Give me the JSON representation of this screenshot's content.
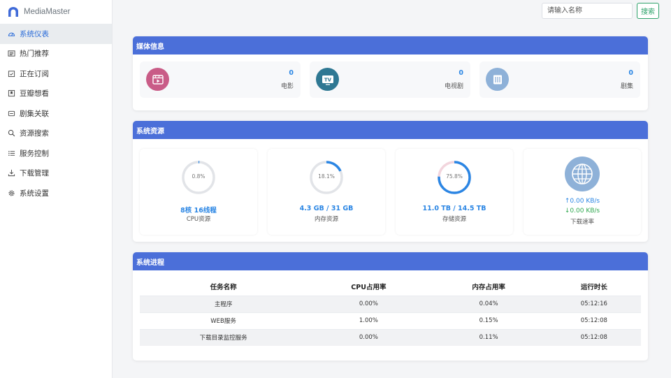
{
  "app": {
    "name": "MediaMaster"
  },
  "sidebar": {
    "items": [
      {
        "label": "系统仪表",
        "icon": "dashboard-icon",
        "active": true
      },
      {
        "label": "热门推荐",
        "icon": "newspaper-icon"
      },
      {
        "label": "正在订阅",
        "icon": "calendar-check-icon"
      },
      {
        "label": "豆瓣想看",
        "icon": "bookmark-box-icon"
      },
      {
        "label": "剧集关联",
        "icon": "link-box-icon"
      },
      {
        "label": "资源搜索",
        "icon": "search-icon"
      },
      {
        "label": "服务控制",
        "icon": "list-icon"
      },
      {
        "label": "下载管理",
        "icon": "download-icon"
      },
      {
        "label": "系统设置",
        "icon": "gear-icon"
      }
    ]
  },
  "search": {
    "placeholder": "请输入名称",
    "button_label": "搜索"
  },
  "media": {
    "title": "媒体信息",
    "tiles": [
      {
        "value": "0",
        "label": "电影",
        "icon": "film-icon",
        "color": "#c95c87"
      },
      {
        "value": "0",
        "label": "电视剧",
        "icon": "tv-icon",
        "color": "#2f7893"
      },
      {
        "value": "0",
        "label": "剧集",
        "icon": "episode-icon",
        "color": "#8eb1d8"
      }
    ]
  },
  "resources": {
    "title": "系统资源",
    "cpu": {
      "percent_text": "0.8%",
      "percent": 0.8,
      "value": "8核 16线程",
      "label": "CPU资源"
    },
    "memory": {
      "percent_text": "18.1%",
      "percent": 18.1,
      "value": "4.3 GB / 31 GB",
      "label": "内存资源"
    },
    "storage": {
      "percent_text": "75.8%",
      "percent": 75.8,
      "value": "11.0 TB / 14.5 TB",
      "label": "存储资源"
    },
    "network": {
      "up": "↑0.00 KB/s",
      "down": "↓0.00 KB/s",
      "label": "下载速率",
      "icon": "globe-icon"
    },
    "colors": {
      "ring_fill": "#2b86e4",
      "ring_track": "#e2e4e8",
      "storage_remain": "#f2d5dd"
    }
  },
  "processes": {
    "title": "系统进程",
    "headers": [
      "任务名称",
      "CPU占用率",
      "内存占用率",
      "运行时长"
    ],
    "rows": [
      [
        "主程序",
        "0.00%",
        "0.04%",
        "05:12:16"
      ],
      [
        "WEB服务",
        "1.00%",
        "0.15%",
        "05:12:08"
      ],
      [
        "下载目录监控服务",
        "0.00%",
        "0.11%",
        "05:12:08"
      ]
    ]
  }
}
